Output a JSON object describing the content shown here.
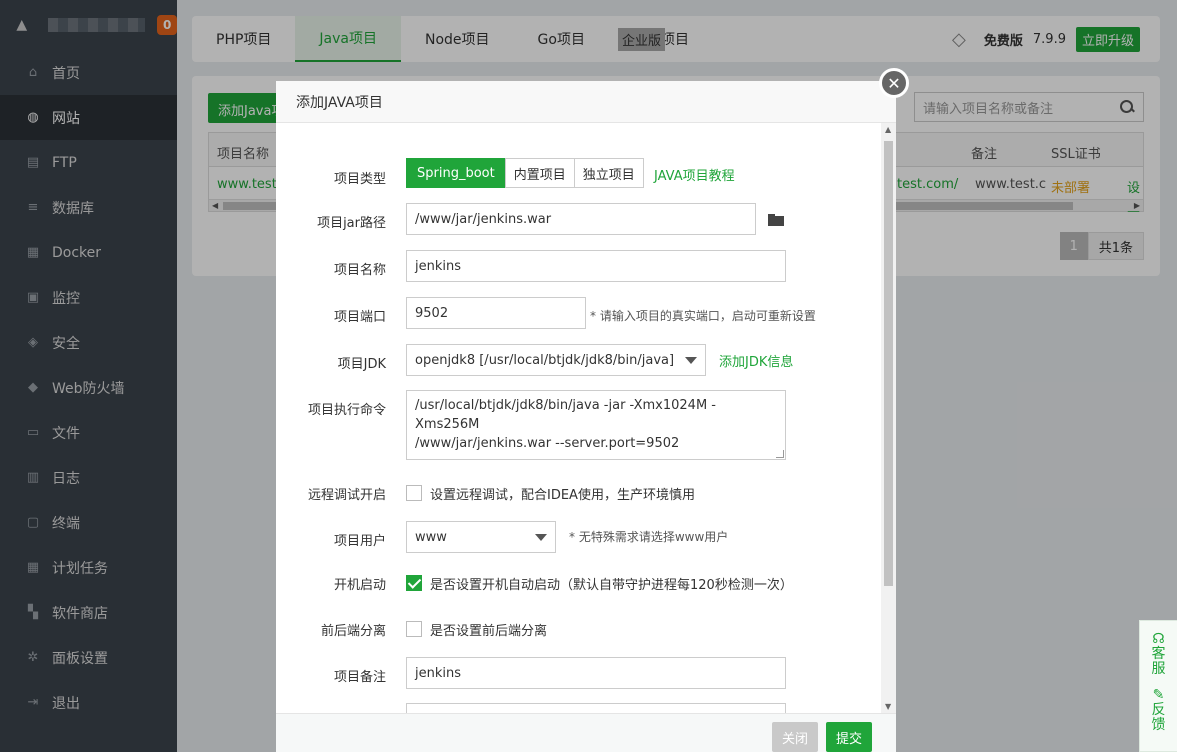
{
  "sidebar": {
    "badge": "0",
    "items": [
      {
        "label": "首页",
        "icon": "home-icon"
      },
      {
        "label": "网站",
        "icon": "globe-icon"
      },
      {
        "label": "FTP",
        "icon": "ftp-icon"
      },
      {
        "label": "数据库",
        "icon": "database-icon"
      },
      {
        "label": "Docker",
        "icon": "docker-icon"
      },
      {
        "label": "监控",
        "icon": "monitor-icon"
      },
      {
        "label": "安全",
        "icon": "shield-icon"
      },
      {
        "label": "Web防火墙",
        "icon": "firewall-icon"
      },
      {
        "label": "文件",
        "icon": "folder-icon"
      },
      {
        "label": "日志",
        "icon": "log-icon"
      },
      {
        "label": "终端",
        "icon": "terminal-icon"
      },
      {
        "label": "计划任务",
        "icon": "calendar-icon"
      },
      {
        "label": "软件商店",
        "icon": "apps-icon"
      },
      {
        "label": "面板设置",
        "icon": "gear-icon"
      },
      {
        "label": "退出",
        "icon": "logout-icon"
      }
    ]
  },
  "topbar": {
    "tabs": [
      "PHP项目",
      "Java项目",
      "Node项目",
      "Go项目",
      "其他项目"
    ],
    "enterprise": "企业版",
    "free": "免费版",
    "version": "7.9.9",
    "upgrade": "立即升级"
  },
  "panel": {
    "add_button": "添加Java项目",
    "search_placeholder": "请输入项目名称或备注",
    "columns": {
      "name": "项目名称",
      "remark": "备注",
      "ssl": "SSL证书"
    },
    "row": {
      "name": "www.test.c",
      "url": "test.com/",
      "remark": "www.test.c",
      "ssl": "未部署",
      "action": "设置"
    },
    "page": "1",
    "total": "共1条"
  },
  "modal": {
    "title": "添加JAVA项目",
    "type_label": "项目类型",
    "types": [
      "Spring_boot",
      "内置项目",
      "独立项目"
    ],
    "tutorial": "JAVA项目教程",
    "jar_label": "项目jar路径",
    "jar_value": "/www/jar/jenkins.war",
    "name_label": "项目名称",
    "name_value": "jenkins",
    "port_label": "项目端口",
    "port_value": "9502",
    "port_tip": "* 请输入项目的真实端口，启动可重新设置",
    "jdk_label": "项目JDK",
    "jdk_value": "openjdk8 [/usr/local/btjdk/jdk8/bin/java]",
    "jdk_link": "添加JDK信息",
    "cmd_label": "项目执行命令",
    "cmd_line1": "/usr/local/btjdk/jdk8/bin/java -jar -Xmx1024M -Xms256M",
    "cmd_line2": "/www/jar/jenkins.war --server.port=9502",
    "debug_label": "远程调试开启",
    "debug_text": "设置远程调试，配合IDEA使用，生产环境慎用",
    "user_label": "项目用户",
    "user_value": "www",
    "user_tip": "* 无特殊需求请选择www用户",
    "boot_label": "开机启动",
    "boot_text": "是否设置开机自动启动（默认自带守护进程每120秒检测一次）",
    "split_label": "前后端分离",
    "split_text": "是否设置前后端分离",
    "remark_label": "项目备注",
    "remark_value": "jenkins",
    "close": "关闭",
    "submit": "提交"
  },
  "service": {
    "label1": "客",
    "label2": "服",
    "label3": "反",
    "label4": "馈"
  },
  "colors": {
    "accent": "#20a53a",
    "sidebar": "#3c444d",
    "badge": "#e4641c"
  }
}
